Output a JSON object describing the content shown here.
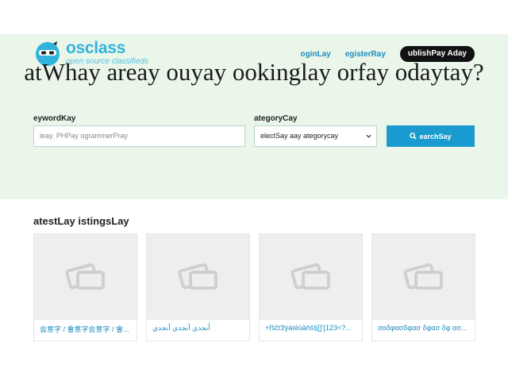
{
  "header": {
    "logo_name": "osclass",
    "logo_tagline": "open source classifieds",
    "nav": {
      "login": "oginLay",
      "register": "egisterRay",
      "publish": "ublishPay Aday"
    }
  },
  "hero": {
    "headline": "atWhay areay ouyay ookinglay orfay odaytay?"
  },
  "search": {
    "keyword_label": "eywordKay",
    "keyword_placeholder": "ieay. PHPay ogrammerPray",
    "category_label": "ategoryCay",
    "category_selected": "electSay aay ategorycay",
    "button_label": "earchSay"
  },
  "latest": {
    "title": "atestLay istingsLay",
    "listings": [
      {
        "title": "会意字 / 會意字会意字 / 會..."
      },
      {
        "title": "أنجدي أنجدي أنجدي"
      },
      {
        "title": "+ľščťžýáíéúäňš§[]'{123<?..."
      },
      {
        "title": "σαδφασδφασ δφασ δφ ασ..."
      }
    ]
  },
  "colors": {
    "accent": "#32b3dc",
    "link": "#1b8cbf",
    "button": "#1a9bd0",
    "hero_bg": "#eaf6ea"
  }
}
